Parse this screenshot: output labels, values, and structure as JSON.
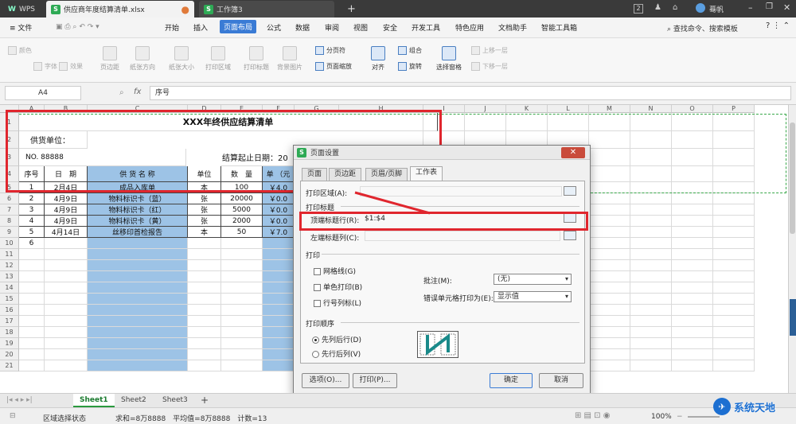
{
  "titlebar": {
    "app_tab": "WPS",
    "file_tab": "供应商年度结算清单.xlsx",
    "book_tab": "工作簿3",
    "new_tab": "+",
    "page_badge": "2",
    "user": "蓦帆"
  },
  "menubar": {
    "file": "≡ 文件",
    "items": [
      "开始",
      "插入",
      "页面布局",
      "公式",
      "数据",
      "审阅",
      "视图",
      "安全",
      "开发工具",
      "特色应用",
      "文档助手",
      "智能工具箱"
    ],
    "active": "页面布局",
    "search": "查找命令、搜索模板"
  },
  "ribbon": {
    "small_left": [
      "颜色",
      "字体",
      "效果"
    ],
    "big": [
      "页边距",
      "纸张方向",
      "纸张大小",
      "打印区域",
      "打印标题",
      "背景图片"
    ],
    "mid_small": [
      "分页符",
      "页面缩放"
    ],
    "big2": [
      "对齐",
      "旋转",
      "选择窗格"
    ],
    "mid_small2": [
      "组合",
      "旋转"
    ],
    "right_small": [
      "上移一层",
      "下移一层"
    ]
  },
  "formula_bar": {
    "cell_ref": "A4",
    "fx": "fx",
    "content": "序号"
  },
  "grid": {
    "columns": [
      "A",
      "B",
      "C",
      "D",
      "E",
      "F",
      "G",
      "H",
      "I",
      "J",
      "K",
      "L",
      "M",
      "N",
      "O",
      "P"
    ],
    "rows": [
      "1",
      "2",
      "3",
      "4",
      "5",
      "6",
      "7",
      "8",
      "9",
      "10",
      "11",
      "12",
      "13",
      "14",
      "15",
      "16",
      "17",
      "18",
      "19",
      "20",
      "21"
    ],
    "title": "XXX年终供应结算清单",
    "supplier_label": "供货单位：",
    "no_label": "NO. 88888",
    "settle_label": "结算起止日期：20",
    "headers": [
      "序号",
      "日　期",
      "供 货 名 称",
      "单位",
      "数　量",
      "单\n（元"
    ],
    "data": [
      [
        "1",
        "2月4日",
        "成品入库单",
        "本",
        "100",
        "￥4.0"
      ],
      [
        "2",
        "4月9日",
        "物料标识卡（蓝）",
        "张",
        "20000",
        "￥0.0"
      ],
      [
        "3",
        "4月9日",
        "物料标识卡（红）",
        "张",
        "5000",
        "￥0.0"
      ],
      [
        "4",
        "4月9日",
        "物料标识卡（黄）",
        "张",
        "2000",
        "￥0.0"
      ],
      [
        "5",
        "4月14日",
        "丝移印首检报告",
        "本",
        "50",
        "￥7.0"
      ],
      [
        "6",
        "",
        "",
        "",
        "",
        ""
      ]
    ]
  },
  "dialog": {
    "title": "页面设置",
    "close": "✕",
    "tabs": [
      "页面",
      "页边距",
      "页眉/页脚",
      "工作表"
    ],
    "active_tab": "工作表",
    "print_area_label": "打印区域(A):",
    "print_titles_label": "打印标题",
    "top_rows_label": "顶端标题行(R):",
    "top_rows_value": "$1:$4",
    "left_cols_label": "左端标题列(C):",
    "print_group": "打印",
    "gridlines": "网格线(G)",
    "mono": "单色打印(B)",
    "rowcol": "行号列标(L)",
    "comments_label": "批注(M):",
    "comments_value": "(无)",
    "errors_label": "错误单元格打印为(E):",
    "errors_value": "显示值",
    "order_group": "打印顺序",
    "order_down": "先列后行(D)",
    "order_over": "先行后列(V)",
    "btn_options": "选项(O)...",
    "btn_print": "打印(P)...",
    "btn_ok": "确定",
    "btn_cancel": "取消"
  },
  "sheets": {
    "tabs": [
      "Sheet1",
      "Sheet2",
      "Sheet3"
    ],
    "active": "Sheet1",
    "add": "+"
  },
  "status": {
    "mode": "区域选择状态",
    "stats": "求和=8万8888　平均值=8万8888　计数=13",
    "zoom": "100%",
    "watermark": "系统天地"
  },
  "colors": {
    "accent": "#3a7bd5",
    "highlight": "#e0262e",
    "cell_blue": "#9dc3e6",
    "wps_green": "#2eaa55"
  }
}
